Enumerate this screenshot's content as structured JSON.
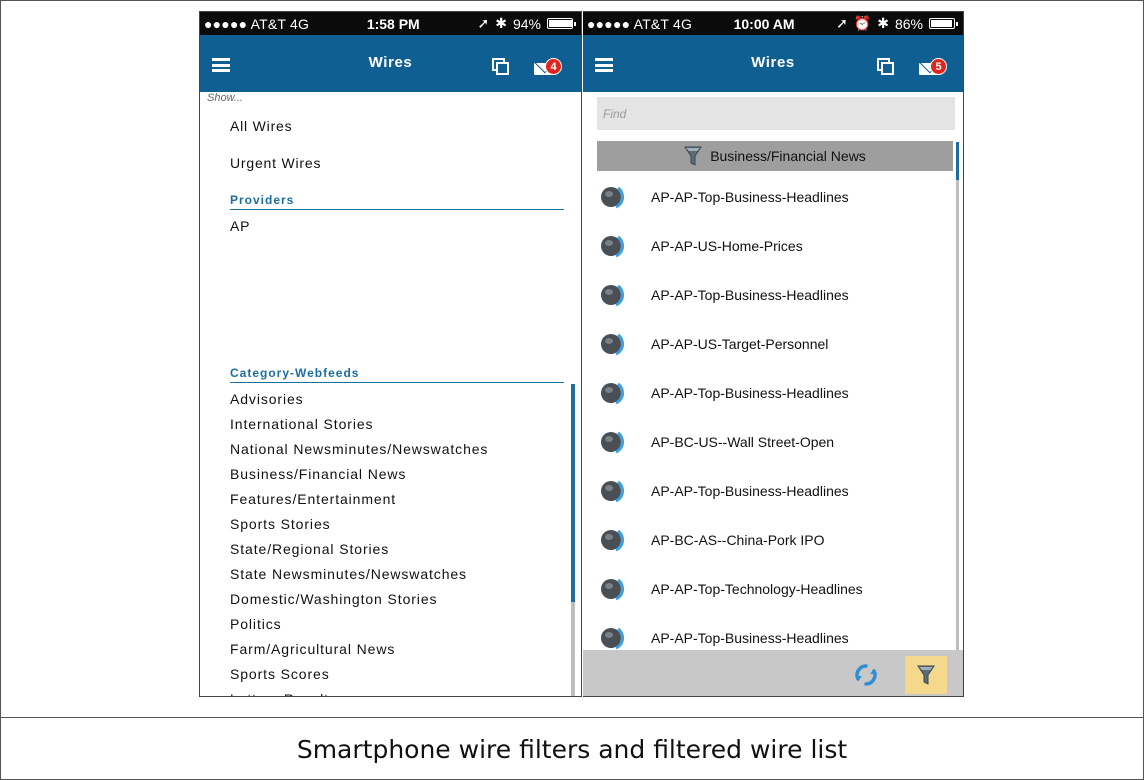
{
  "caption": "Smartphone wire filters and filtered wire list",
  "colors": {
    "nav_bar": "#0f5f93",
    "accent": "#1c6ea0",
    "badge": "#e1231c",
    "filter_highlight": "#f4d88c"
  },
  "left_phone": {
    "status": {
      "carrier": "●●●●● AT&T  4G",
      "time": "1:58 PM",
      "battery": "94%",
      "battery_level": 0.94
    },
    "nav": {
      "title": "Wires",
      "badge_count": "4",
      "icons": [
        "hamburger-icon",
        "copy-icon",
        "mail-icon"
      ]
    },
    "show_label": "Show...",
    "show_options": [
      "All Wires",
      "Urgent Wires"
    ],
    "providers_header": "Providers",
    "providers": [
      "AP"
    ],
    "category_header": "Category-Webfeeds",
    "categories": [
      "Advisories",
      "International Stories",
      "National Newsminutes/Newswatches",
      "Business/Financial News",
      "Features/Entertainment",
      "Sports Stories",
      "State/Regional Stories",
      "State Newsminutes/Newswatches",
      "Domestic/Washington Stories",
      "Politics",
      "Farm/Agricultural News",
      "Sports Scores",
      "Lottery Results"
    ]
  },
  "right_phone": {
    "status": {
      "carrier": "●●●●● AT&T  4G",
      "time": "10:00 AM",
      "battery": "86%",
      "battery_level": 0.86
    },
    "nav": {
      "title": "Wires",
      "badge_count": "5",
      "icons": [
        "hamburger-icon",
        "copy-icon",
        "mail-icon"
      ]
    },
    "find_placeholder": "Find",
    "active_filter": "Business/Financial News",
    "wires": [
      "AP-AP-Top-Business-Headlines",
      "AP-AP-US-Home-Prices",
      "AP-AP-Top-Business-Headlines",
      "AP-AP-US-Target-Personnel",
      "AP-AP-Top-Business-Headlines",
      "AP-BC-US--Wall Street-Open",
      "AP-AP-Top-Business-Headlines",
      "AP-BC-AS--China-Pork IPO",
      "AP-AP-Top-Technology-Headlines",
      "AP-AP-Top-Business-Headlines"
    ],
    "toolbar_icons": [
      "refresh-icon",
      "filter-icon"
    ]
  }
}
